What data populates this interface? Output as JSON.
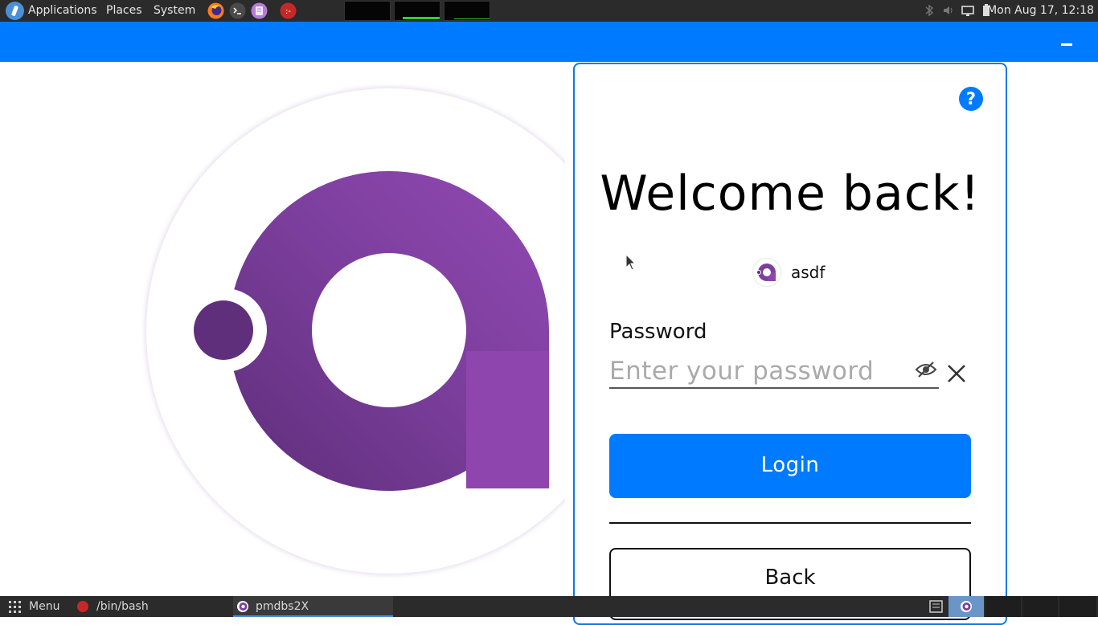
{
  "top_panel": {
    "menus": [
      "Applications",
      "Places",
      "System"
    ],
    "clock": "Mon Aug 17, 12:18"
  },
  "icons": {
    "os_logo": "os-logo-icon",
    "browser": "firefox-icon",
    "terminal": "terminal-icon",
    "text_editor": "text-editor-icon",
    "app": "red-app-icon",
    "help": "help-icon",
    "visibility": "eye-off-icon",
    "clear": "close-icon"
  },
  "login": {
    "title": "Welcome back!",
    "account_name": "asdf",
    "password_label": "Password",
    "password_placeholder": "Enter your password",
    "password_value": "",
    "help_glyph": "?",
    "login_label": "Login",
    "back_label": "Back"
  },
  "taskbar": {
    "menu_label": "Menu",
    "tasks": [
      {
        "label": "/bin/bash"
      },
      {
        "label": "pmdbs2X"
      }
    ]
  },
  "colors": {
    "accent": "#007bff",
    "panel": "#2b2b2b",
    "logo_purple": "#8e44ad"
  }
}
